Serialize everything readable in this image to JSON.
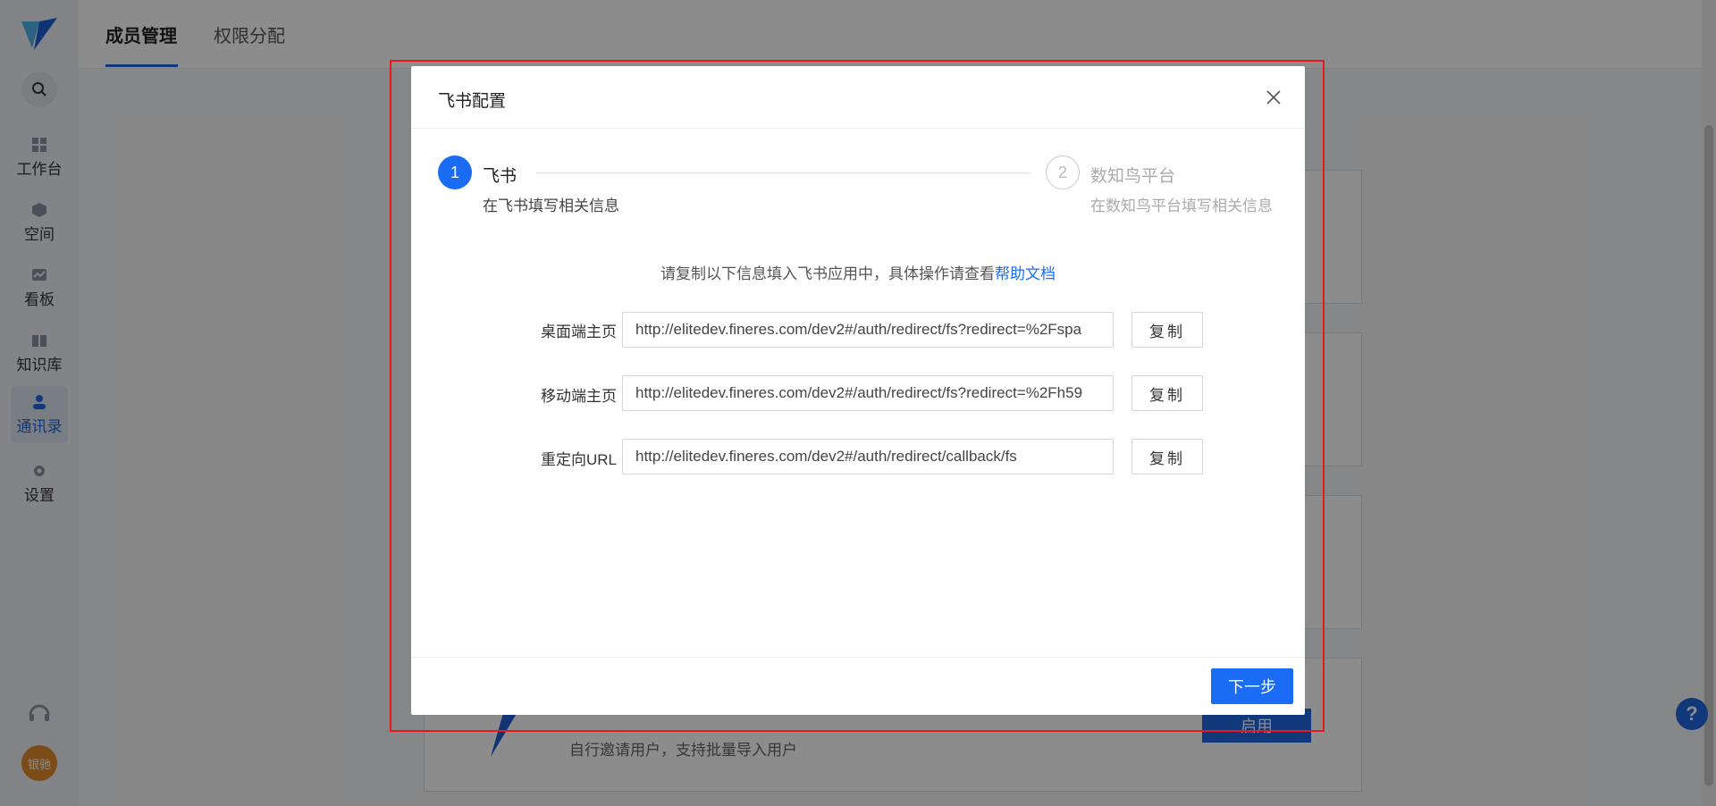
{
  "sidebar": {
    "items": [
      {
        "label": "工作台",
        "icon": "dashboard-icon"
      },
      {
        "label": "空间",
        "icon": "cube-icon"
      },
      {
        "label": "看板",
        "icon": "chart-board-icon"
      },
      {
        "label": "知识库",
        "icon": "book-icon"
      },
      {
        "label": "通讯录",
        "icon": "contacts-icon",
        "active": true
      },
      {
        "label": "设置",
        "icon": "gear-icon"
      }
    ],
    "avatar_text": "银驰"
  },
  "header": {
    "tabs": [
      {
        "label": "成员管理",
        "active": true
      },
      {
        "label": "权限分配",
        "active": false
      }
    ]
  },
  "background": {
    "card_button_label": "启用",
    "card_description": "自行邀请用户，支持批量导入用户"
  },
  "modal": {
    "title": "飞书配置",
    "steps": [
      {
        "number": "1",
        "title": "飞书",
        "description": "在飞书填写相关信息",
        "active": true
      },
      {
        "number": "2",
        "title": "数知鸟平台",
        "description": "在数知鸟平台填写相关信息",
        "active": false
      }
    ],
    "hint_prefix": "请复制以下信息填入飞书应用中，具体操作请查看",
    "hint_link": "帮助文档",
    "rows": [
      {
        "label": "桌面端主页",
        "value": "http://elitedev.fineres.com/dev2#/auth/redirect/fs?redirect=%2Fspa",
        "copy_label": "复制"
      },
      {
        "label": "移动端主页",
        "value": "http://elitedev.fineres.com/dev2#/auth/redirect/fs?redirect=%2Fh59",
        "copy_label": "复制"
      },
      {
        "label": "重定向URL",
        "value": "http://elitedev.fineres.com/dev2#/auth/redirect/callback/fs",
        "copy_label": "复制"
      }
    ],
    "next_label": "下一步"
  },
  "floating_help": "?",
  "colors": {
    "primary": "#1a6cf5",
    "highlight_frame": "#e8191c",
    "avatar": "#e08a2a"
  }
}
